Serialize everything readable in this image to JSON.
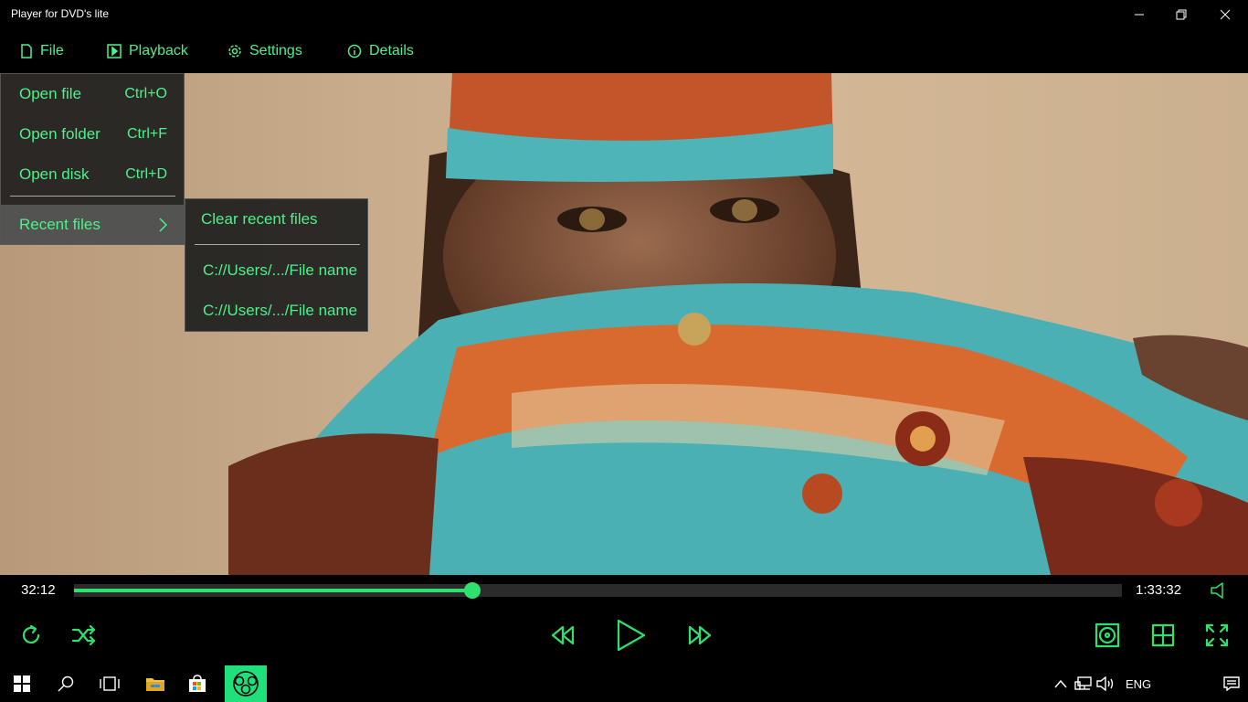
{
  "window": {
    "title": "Player for DVD's lite"
  },
  "menu": {
    "file": "File",
    "playback": "Playback",
    "settings": "Settings",
    "details": "Details"
  },
  "file_menu": {
    "items": [
      {
        "label": "Open file",
        "shortcut": "Ctrl+O"
      },
      {
        "label": "Open folder",
        "shortcut": "Ctrl+F"
      },
      {
        "label": "Open disk",
        "shortcut": "Ctrl+D"
      }
    ],
    "recent_label": "Recent files"
  },
  "recent_menu": {
    "clear": "Clear recent files",
    "files": [
      "C://Users/.../File name",
      "C://Users/.../File name"
    ]
  },
  "player": {
    "elapsed": "32:12",
    "total": "1:33:32",
    "progress": 0.38
  },
  "taskbar": {
    "language": "ENG"
  },
  "colors": {
    "accent": "#2ee06e",
    "menu_text": "#4ef08a"
  }
}
